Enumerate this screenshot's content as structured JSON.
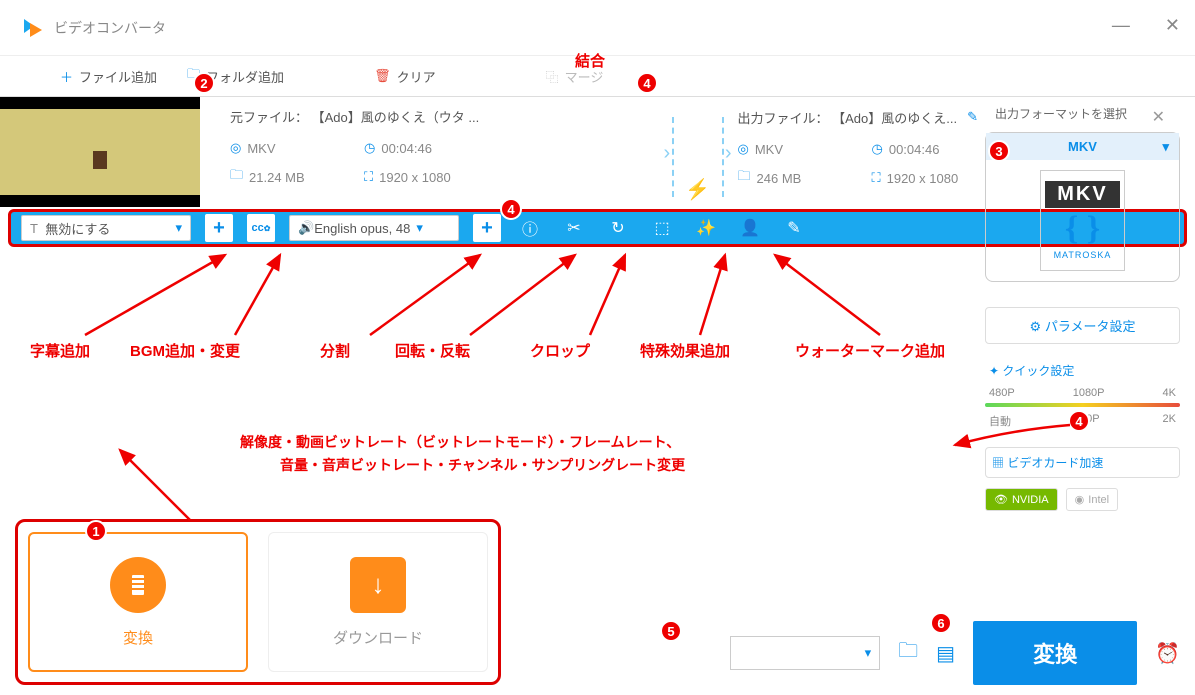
{
  "app": {
    "title": "ビデオコンバータ"
  },
  "toolbar": {
    "add_file": "ファイル追加",
    "add_folder": "フォルダ追加",
    "clear": "クリア",
    "merge": "マージ"
  },
  "source": {
    "label": "元ファイル：",
    "name": "【Ado】風のゆくえ（ウタ ...",
    "format": "MKV",
    "duration": "00:04:46",
    "size": "21.24 MB",
    "resolution": "1920 x 1080"
  },
  "output": {
    "label": "出力ファイル：",
    "name": "【Ado】風のゆくえ...",
    "format": "MKV",
    "duration": "00:04:46",
    "size": "246 MB",
    "resolution": "1920 x 1080"
  },
  "bluebar": {
    "subtitle_dd": "無効にする",
    "audio_dd": "English opus, 48"
  },
  "right": {
    "title": "出力フォーマットを選択",
    "format": "MKV",
    "logo_sub": "MATROSKA",
    "param": "パラメータ設定",
    "quick": "クイック設定",
    "q1": [
      "480P",
      "1080P",
      "4K"
    ],
    "q2": [
      "自動",
      "720P",
      "2K"
    ],
    "gpu": "ビデオカード加速",
    "nvidia": "NVIDIA",
    "intel": "Intel"
  },
  "bottom": {
    "convert_tab": "変換",
    "download_tab": "ダウンロード",
    "convert_btn": "変換"
  },
  "ann": {
    "merge": "結合",
    "sub": "字幕追加",
    "bgm": "BGM追加・変更",
    "split": "分割",
    "rotate": "回転・反転",
    "crop": "クロップ",
    "fx": "特殊効果追加",
    "wm": "ウォーターマーク追加",
    "param1": "解像度・動画ビットレート（ビットレートモード）・フレームレート、",
    "param2": "音量・音声ビットレート・チャンネル・サンプリングレート変更"
  }
}
